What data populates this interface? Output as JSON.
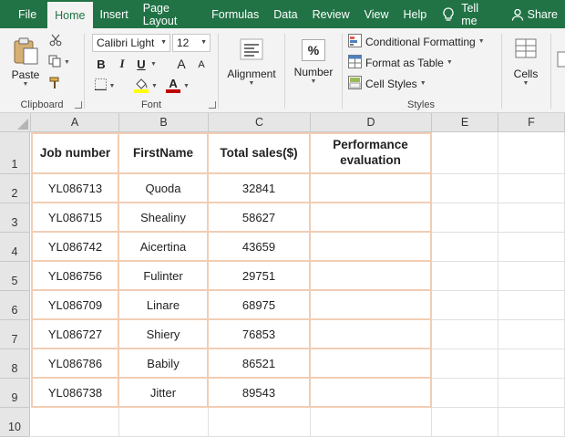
{
  "menu": {
    "tabs": [
      "File",
      "Home",
      "Insert",
      "Page Layout",
      "Formulas",
      "Data",
      "Review",
      "View",
      "Help"
    ],
    "tell_me": "Tell me",
    "share": "Share"
  },
  "ribbon": {
    "clipboard": {
      "paste_label": "Paste",
      "group_label": "Clipboard"
    },
    "font": {
      "font_name": "Calibri Light",
      "font_size": "12",
      "group_label": "Font",
      "bold": "B",
      "italic": "I",
      "underline": "U",
      "grow": "A",
      "shrink": "A",
      "font_color_glyph": "A",
      "fill_color": "#ffff00",
      "font_color": "#c00000"
    },
    "alignment": {
      "label": "Alignment"
    },
    "number": {
      "label": "Number",
      "percent": "%"
    },
    "styles": {
      "conditional": "Conditional Formatting",
      "format_table": "Format as Table",
      "cell_styles": "Cell Styles",
      "group_label": "Styles"
    },
    "cells": {
      "label": "Cells"
    }
  },
  "grid": {
    "columns": [
      "A",
      "B",
      "C",
      "D",
      "E",
      "F"
    ],
    "rows": [
      "1",
      "2",
      "3",
      "4",
      "5",
      "6",
      "7",
      "8",
      "9",
      "10"
    ],
    "headers": [
      "Job number",
      "FirstName",
      "Total sales($)",
      "Performance evaluation"
    ],
    "data": [
      [
        "YL086713",
        "Quoda",
        "32841",
        ""
      ],
      [
        "YL086715",
        "Shealiny",
        "58627",
        ""
      ],
      [
        "YL086742",
        "Aicertina",
        "43659",
        ""
      ],
      [
        "YL086756",
        "Fulinter",
        "29751",
        ""
      ],
      [
        "YL086709",
        "Linare",
        "68975",
        ""
      ],
      [
        "YL086727",
        "Shiery",
        "76853",
        ""
      ],
      [
        "YL086786",
        "Babily",
        "86521",
        ""
      ],
      [
        "YL086738",
        "Jitter",
        "89543",
        ""
      ]
    ]
  },
  "colors": {
    "brand": "#217346",
    "table_border": "#f1cdb4"
  }
}
